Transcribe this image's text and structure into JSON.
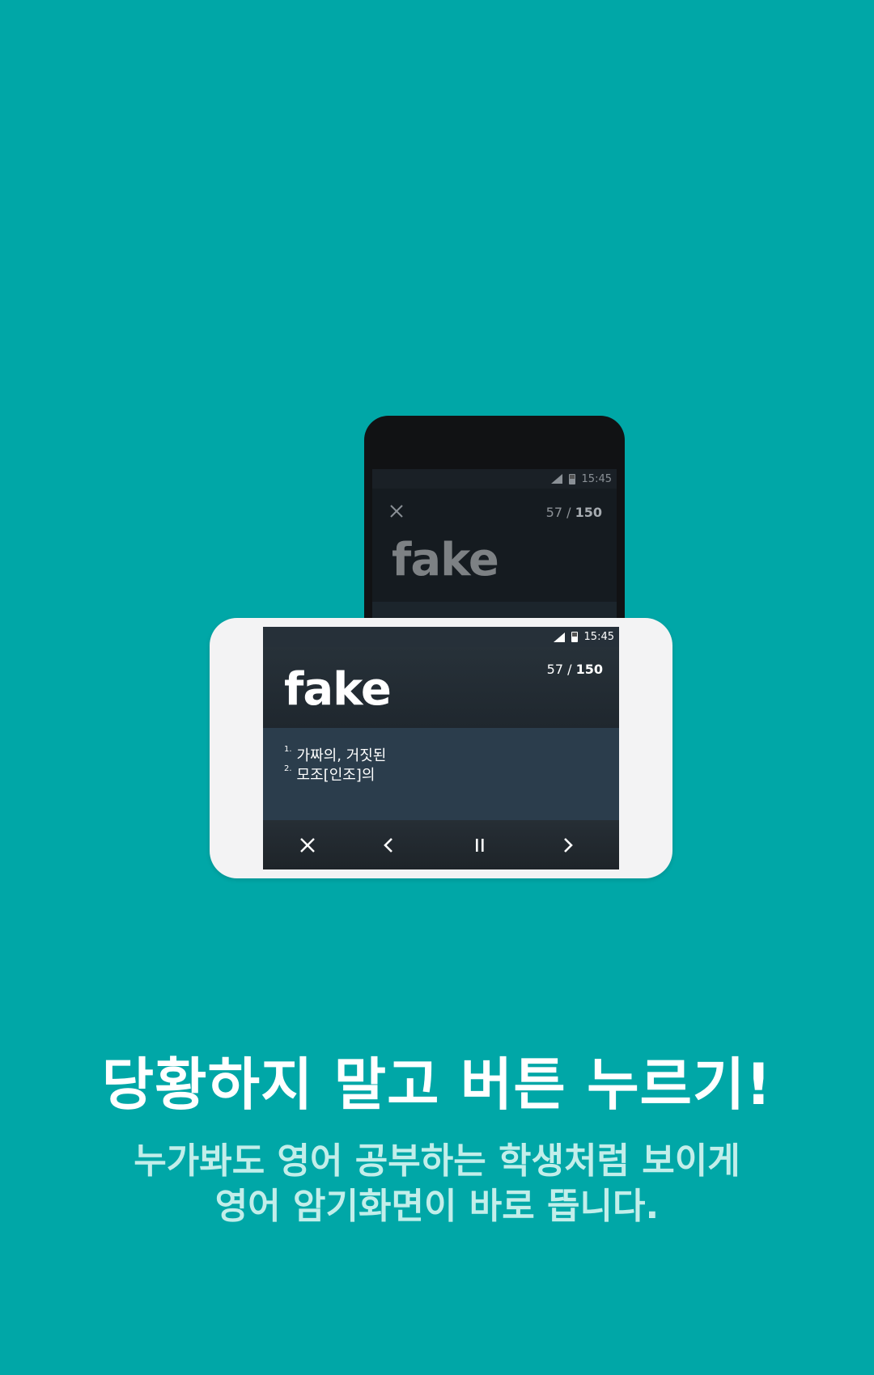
{
  "back_phone": {
    "time": "15:45",
    "counter_current": "57 / ",
    "counter_total": "150",
    "word": "fake"
  },
  "front_phone": {
    "time": "15:45",
    "word": "fake",
    "counter_current": "57 / ",
    "counter_total": "150",
    "definitions": [
      {
        "num": "1.",
        "text": "가짜의, 거짓된"
      },
      {
        "num": "2.",
        "text": "모조[인조]의"
      }
    ],
    "controls": [
      "close-icon",
      "chevron-left-icon",
      "pause-icon",
      "chevron-right-icon"
    ]
  },
  "caption": {
    "headline": "당황하지 말고 버튼 누르기!",
    "subline_1": "누가봐도 영어 공부하는 학생처럼 보이게",
    "subline_2": "영어 암기화면이 바로 뜹니다."
  },
  "colors": {
    "background": "#00a7a7",
    "definition_panel": "#2b3d4c",
    "subline": "#c2eeea"
  }
}
